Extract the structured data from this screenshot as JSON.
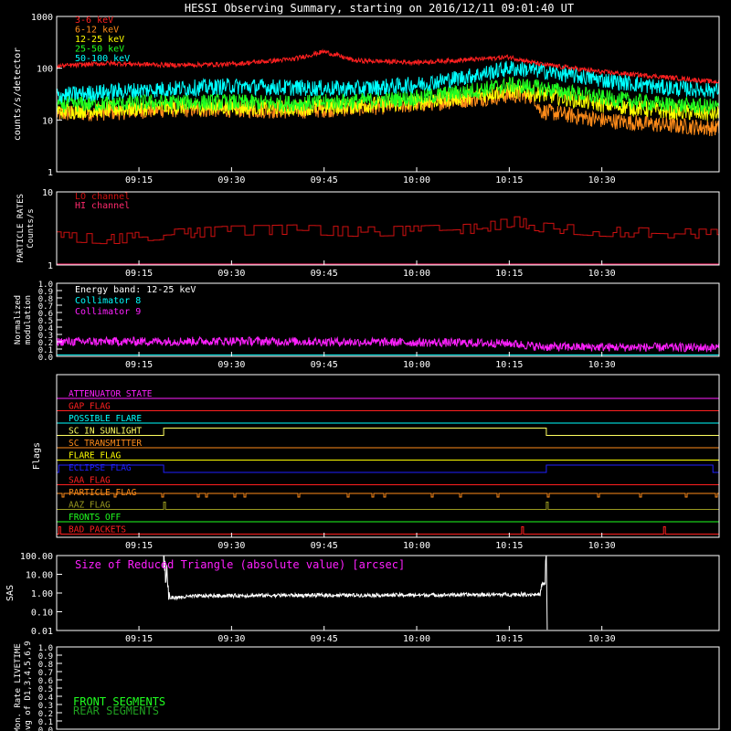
{
  "page": {
    "title": "HESSI Observing Summary, starting on 2016/12/11 09:01:40 UT"
  },
  "colors": {
    "background": "#000000",
    "axes": "#ffffff",
    "red": "#ff2020",
    "orange": "#ff8c1a",
    "yellow": "#ffff00",
    "green": "#20ff20",
    "cyan": "#00ffff",
    "magenta": "#ff20ff",
    "dred": "#d01010",
    "blue": "#2020ff",
    "olive": "#9a9a20",
    "dgreen": "#20a020"
  },
  "chart_data": [
    {
      "type": "line",
      "panel": "count-rates",
      "ylabel": "counts/s/detector",
      "yscale": "log",
      "ylim": [
        1,
        1000
      ],
      "yticks": [
        "1",
        "10",
        "100",
        "1000"
      ],
      "xticks": [
        "09:15",
        "09:30",
        "09:45",
        "10:00",
        "10:15",
        "10:30"
      ],
      "legend_placement": "top-left",
      "series": [
        {
          "name": "3-6 keV",
          "color": "#ff2020",
          "x": [
            "09:02",
            "09:10",
            "09:20",
            "09:30",
            "09:40",
            "09:45",
            "09:50",
            "10:00",
            "10:10",
            "10:15",
            "10:20",
            "10:30",
            "10:40",
            "10:48"
          ],
          "values": [
            110,
            125,
            115,
            120,
            150,
            210,
            140,
            130,
            150,
            165,
            120,
            85,
            68,
            55
          ]
        },
        {
          "name": "6-12 keV",
          "color": "#ff8c1a",
          "x": [
            "09:02",
            "09:10",
            "09:20",
            "09:30",
            "09:40",
            "09:50",
            "10:00",
            "10:10",
            "10:15",
            "10:19",
            "10:20",
            "10:30",
            "10:40",
            "10:48"
          ],
          "values": [
            13,
            14,
            16,
            16,
            15,
            17,
            20,
            26,
            30,
            29,
            15,
            10,
            8,
            7
          ]
        },
        {
          "name": "12-25 keV",
          "color": "#ffff00",
          "x": [
            "09:02",
            "09:10",
            "09:20",
            "09:30",
            "09:40",
            "09:50",
            "10:00",
            "10:10",
            "10:15",
            "10:20",
            "10:30",
            "10:40",
            "10:48"
          ],
          "values": [
            15,
            16,
            18,
            18,
            17,
            19,
            22,
            30,
            38,
            32,
            20,
            15,
            13
          ]
        },
        {
          "name": "25-50 keV",
          "color": "#20ff20",
          "x": [
            "09:02",
            "09:10",
            "09:20",
            "09:30",
            "09:40",
            "09:50",
            "10:00",
            "10:10",
            "10:15",
            "10:20",
            "10:30",
            "10:40",
            "10:48"
          ],
          "values": [
            20,
            21,
            22,
            22,
            21,
            23,
            27,
            38,
            48,
            42,
            27,
            20,
            18
          ]
        },
        {
          "name": "50-100 keV",
          "color": "#00ffff",
          "x": [
            "09:02",
            "09:10",
            "09:20",
            "09:30",
            "09:40",
            "09:50",
            "10:00",
            "10:10",
            "10:15",
            "10:20",
            "10:30",
            "10:40",
            "10:48"
          ],
          "values": [
            30,
            35,
            40,
            45,
            42,
            40,
            48,
            75,
            100,
            90,
            60,
            42,
            38
          ]
        }
      ]
    },
    {
      "type": "line",
      "panel": "particle-rates",
      "ylabel": "PARTICLE RATES Counts/s",
      "yscale": "log",
      "ylim": [
        1,
        10
      ],
      "yticks": [
        "1",
        "10"
      ],
      "xticks": [
        "09:15",
        "09:30",
        "09:45",
        "10:00",
        "10:15",
        "10:30"
      ],
      "series": [
        {
          "name": "LO channel",
          "color": "#d01010",
          "x": [
            "09:02",
            "09:10",
            "09:20",
            "09:30",
            "09:40",
            "09:50",
            "10:00",
            "10:10",
            "10:13",
            "10:16",
            "10:20",
            "10:30",
            "10:48"
          ],
          "values": [
            2.4,
            2.2,
            2.6,
            2.9,
            3.0,
            2.8,
            2.9,
            3.1,
            3.5,
            3.9,
            3.2,
            2.8,
            2.6
          ]
        },
        {
          "name": "HI channel",
          "color": "#ff2a6d",
          "x": [
            "09:02",
            "10:48"
          ],
          "values": [
            1.0,
            1.0
          ]
        }
      ]
    },
    {
      "type": "line",
      "panel": "modulation",
      "ylabel": "Normalized modulation",
      "ylim": [
        0,
        1
      ],
      "yticks": [
        "0.0",
        "0.1",
        "0.2",
        "0.3",
        "0.4",
        "0.5",
        "0.6",
        "0.7",
        "0.8",
        "0.9",
        "1.0"
      ],
      "xticks": [
        "09:15",
        "09:30",
        "09:45",
        "10:00",
        "10:15",
        "10:30"
      ],
      "annotation": "Energy band: 12-25 keV",
      "series": [
        {
          "name": "Collimator 8",
          "color": "#00ffff",
          "x": [
            "09:02",
            "10:48"
          ],
          "values": [
            0.02,
            0.02
          ]
        },
        {
          "name": "Collimator 9",
          "color": "#ff20ff",
          "x": [
            "09:02",
            "09:30",
            "10:00",
            "10:15",
            "10:20",
            "10:48"
          ],
          "values": [
            0.2,
            0.21,
            0.19,
            0.18,
            0.13,
            0.12
          ]
        }
      ]
    },
    {
      "type": "line",
      "panel": "flags",
      "ylabel": "Flags",
      "xticks": [
        "09:15",
        "09:30",
        "09:45",
        "10:00",
        "10:15",
        "10:30"
      ],
      "flags": [
        {
          "name": "ATTENUATOR STATE",
          "color": "#ff20ff",
          "segments": []
        },
        {
          "name": "GAP FLAG",
          "color": "#ff2020",
          "segments": []
        },
        {
          "name": "POSSIBLE FLARE",
          "color": "#00ffff",
          "segments": []
        },
        {
          "name": "SC IN SUNLIGHT",
          "color": "#ffff60",
          "segments": [
            [
              "09:19",
              "10:21"
            ]
          ]
        },
        {
          "name": "SC TRANSMITTER",
          "color": "#ff8c1a",
          "segments": []
        },
        {
          "name": "FLARE FLAG",
          "color": "#ffff00",
          "segments": []
        },
        {
          "name": "ECLIPSE FLAG",
          "color": "#2020ff",
          "segments": [
            [
              "09:02",
              "09:19"
            ],
            [
              "10:21",
              "10:48"
            ]
          ]
        },
        {
          "name": "SAA FLAG",
          "color": "#ff2020",
          "segments": []
        },
        {
          "name": "PARTICLE FLAG",
          "color": "#ff8c1a",
          "segments": [
            [
              "09:02",
              "10:48"
            ]
          ]
        },
        {
          "name": "AAZ FLAG",
          "color": "#9a9a20",
          "segments": [
            [
              "09:19",
              "09:19"
            ],
            [
              "10:21",
              "10:21"
            ]
          ]
        },
        {
          "name": "FRONTS OFF",
          "color": "#20ff20",
          "segments": []
        },
        {
          "name": "BAD PACKETS",
          "color": "#ff2020",
          "segments": [
            [
              "09:02",
              "09:02"
            ],
            [
              "10:17",
              "10:17"
            ],
            [
              "10:40",
              "10:40"
            ]
          ]
        }
      ]
    },
    {
      "type": "line",
      "panel": "sas",
      "ylabel": "SAS",
      "yscale": "log",
      "ylim": [
        0.01,
        100
      ],
      "yticks": [
        "0.01",
        "0.10",
        "1.00",
        "10.00",
        "100.00"
      ],
      "xticks": [
        "09:15",
        "09:30",
        "09:45",
        "10:00",
        "10:15",
        "10:30"
      ],
      "annotation": "Size of Reduced Triangle (absolute value) [arcsec]",
      "series": [
        {
          "name": "SAS",
          "color": "#ffffff",
          "x": [
            "09:19",
            "09:20",
            "09:25",
            "09:35",
            "10:00",
            "10:20",
            "10:21"
          ],
          "values": [
            100,
            0.55,
            0.7,
            0.75,
            0.78,
            0.85,
            100
          ]
        }
      ]
    },
    {
      "type": "line",
      "panel": "livetime",
      "ylabel": "Mon. Rate LIVETIME avg of D1,3,4,5,6,9",
      "ylim": [
        0,
        1
      ],
      "yticks": [
        "0.0",
        "0.1",
        "0.2",
        "0.3",
        "0.4",
        "0.5",
        "0.6",
        "0.7",
        "0.8",
        "0.9",
        "1.0"
      ],
      "series": [
        {
          "name": "FRONT SEGMENTS",
          "color": "#20ff20",
          "x": [],
          "values": []
        },
        {
          "name": "REAR SEGMENTS",
          "color": "#20a020",
          "x": [],
          "values": []
        }
      ]
    }
  ]
}
